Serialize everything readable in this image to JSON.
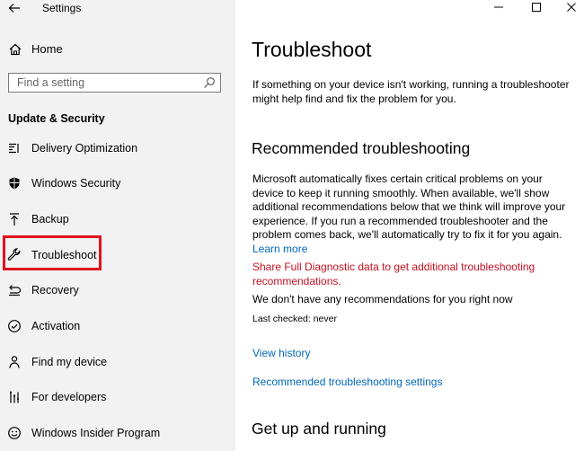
{
  "window": {
    "title": "Settings",
    "controls": [
      "minimize-icon",
      "maximize-icon",
      "close-icon"
    ]
  },
  "sidebar": {
    "home_label": "Home",
    "search": {
      "placeholder": "Find a setting"
    },
    "section_heading": "Update & Security",
    "items": [
      {
        "label": "Delivery Optimization",
        "icon": "delivery-optimization-icon"
      },
      {
        "label": "Windows Security",
        "icon": "shield-icon"
      },
      {
        "label": "Backup",
        "icon": "backup-arrow-icon"
      },
      {
        "label": "Troubleshoot",
        "icon": "wrench-icon",
        "selected": true
      },
      {
        "label": "Recovery",
        "icon": "recovery-icon"
      },
      {
        "label": "Activation",
        "icon": "activation-check-icon"
      },
      {
        "label": "Find my device",
        "icon": "find-device-icon"
      },
      {
        "label": "For developers",
        "icon": "developer-tools-icon"
      },
      {
        "label": "Windows Insider Program",
        "icon": "insider-smiley-icon"
      }
    ],
    "highlight_color": "#e0131d"
  },
  "main": {
    "title": "Troubleshoot",
    "intro": "If something on your device isn't working, running a troubleshooter might help find and fix the problem for you.",
    "recommended": {
      "heading": "Recommended troubleshooting",
      "description": "Microsoft automatically fixes certain critical problems on your device to keep it running smoothly. When available, we'll show additional recommendations below that we think will improve your experience. If you run a recommended troubleshooter and the problem comes back, we'll automatically try to fix it for you again.",
      "learn_more": "Learn more",
      "diagnostic_link": "Share Full Diagnostic data to get additional troubleshooting recommendations.",
      "no_recommendations": "We don't have any recommendations for you right now",
      "last_checked": "Last checked: never",
      "view_history": "View history",
      "settings_link": "Recommended troubleshooting settings"
    },
    "get_up_heading": "Get up and running"
  },
  "colors": {
    "link": "#0067b8",
    "warning_link": "#c50f1f",
    "sidebar_bg": "#f2f2f2"
  }
}
